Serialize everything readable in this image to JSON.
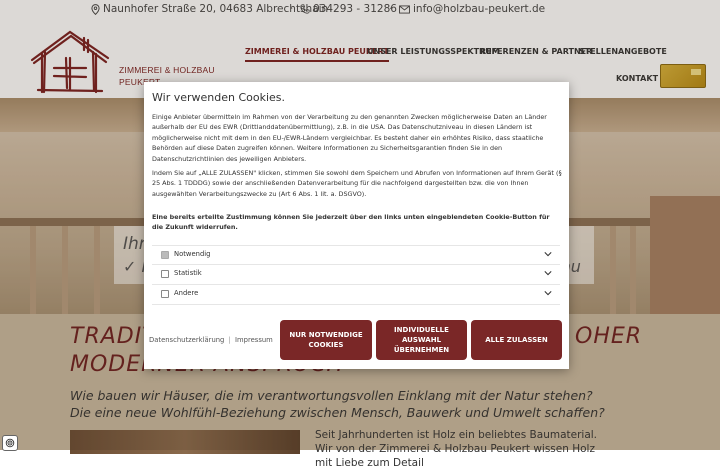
{
  "topbar": {
    "address": "Naunhofer Straße 20, 04683 Albrechtshain",
    "phone": "034293 - 31286",
    "email": "info@holzbau-peukert.de",
    "separator": "·"
  },
  "header": {
    "brand_line1": "ZIMMEREI & HOLZBAU",
    "brand_line2": "PEUKERT",
    "nav": [
      {
        "label": "ZIMMEREI & HOLZBAU PEUKERT",
        "active": true
      },
      {
        "label": "UNSER LEISTUNGSSPEKTRUM"
      },
      {
        "label": "REFERENZEN & PARTNER"
      },
      {
        "label": "STELLENANGEBOTE"
      },
      {
        "label": "KONTAKT"
      }
    ]
  },
  "hero": {
    "line1": "Ihr",
    "line2": "✓ I",
    "line2_tail": "au"
  },
  "content": {
    "title_line1_left": "TRADIT",
    "title_line1_right": "OHER",
    "title_line2": "MODERNER ANSPRUCH",
    "subtitle1": "Wie bauen wir Häuser, die im verantwortungsvollen Einklang mit der Natur stehen?",
    "subtitle2": "Die eine neue Wohlfühl-Beziehung zwischen Mensch, Bauwerk und Umwelt schaffen?",
    "body": "Seit Jahrhunderten ist Holz ein beliebtes Baumaterial. Wir von der Zimmerei & Holzbau Peukert wissen Holz mit Liebe zum Detail"
  },
  "cookie": {
    "title": "Wir verwenden Cookies.",
    "para1": "Einige Anbieter übermitteln im Rahmen von der Verarbeitung zu den genannten Zwecken möglicherweise Daten an Länder außerhalb der EU des EWR (Drittlanddatenübermittlung), z.B. in die USA. Das Datenschutzniveau in diesen Ländern ist möglicherweise nicht mit dem in den EU-/EWR-Ländern vergleichbar. Es besteht daher ein erhöhtes Risiko, dass staatliche Behörden auf diese Daten zugreifen können. Weitere Informationen zu Sicherheitsgarantien finden Sie in den Datenschutzrichtlinien des jeweiligen Anbieters.",
    "para2": "Indem Sie auf „ALLE ZULASSEN\" klicken, stimmen Sie sowohl dem Speichern und Abrufen von Informationen auf Ihrem Gerät (§ 25 Abs. 1 TDDDG) sowie der anschließenden Datenverarbeitung für die nachfolgend dargestellten bzw. die von Ihnen ausgewählten Verarbeitungszwecke zu (Art 6 Abs. 1 lit. a. DSGVO).",
    "para3": "Eine bereits erteilte Zustimmung können Sie jederzeit über den links unten eingeblendeten Cookie-Button für die Zukunft widerrufen.",
    "categories": [
      {
        "label": "Notwendig",
        "checked": true
      },
      {
        "label": "Statistik",
        "checked": false
      },
      {
        "label": "Andere",
        "checked": false
      }
    ],
    "link_privacy": "Datenschutzerklärung",
    "link_sep": "|",
    "link_imprint": "Impressum",
    "btn_necessary_l1": "NUR NOTWENDIGE",
    "btn_necessary_l2": "COOKIES",
    "btn_custom_l1": "INDIVIDUELLE",
    "btn_custom_l2": "AUSWAHL",
    "btn_custom_l3": "ÜBERNEHMEN",
    "btn_all": "ALLE ZULASSEN",
    "accent_color": "#7a2727"
  },
  "privacy_fab": {
    "icon": "fingerprint-icon"
  }
}
